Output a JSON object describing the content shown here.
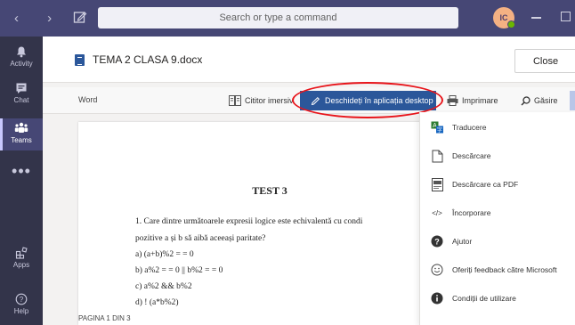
{
  "titlebar": {
    "nav_arrows": "‹  ›",
    "search_placeholder": "Search or type a command",
    "avatar_initials": "IC"
  },
  "rail": {
    "items": [
      {
        "label": "Activity"
      },
      {
        "label": "Chat"
      },
      {
        "label": "Teams"
      },
      {
        "label": "Apps"
      },
      {
        "label": "Help"
      }
    ],
    "more": "•••"
  },
  "document": {
    "title": "TEMA 2 CLASA 9.docx",
    "close_label": "Close",
    "app_label": "Word"
  },
  "toolbar": {
    "immersive_reader": "Cititor imersiv",
    "open_desktop": "Deschideți în aplicația desktop",
    "print": "Imprimare",
    "find": "Găsire"
  },
  "page": {
    "heading": "TEST 3",
    "lines": [
      "1. Care dintre următoarele expresii logice este echivalentă cu condi",
      "pozitive a și b să aibă aceeași paritate?",
      "a) (a+b)%2 = = 0",
      "b) a%2 = = 0 || b%2 = = 0",
      "c) a%2 && b%2",
      "d) ! (a*b%2)"
    ]
  },
  "status": {
    "page_indicator": "PAGINA 1 DIN 3"
  },
  "menu": {
    "items": [
      {
        "label": "Traducere",
        "icon": "translate-icon"
      },
      {
        "label": "Descărcare",
        "icon": "download-icon"
      },
      {
        "label": "Descărcare ca PDF",
        "icon": "pdf-icon"
      },
      {
        "label": "Încorporare",
        "icon": "embed-icon"
      },
      {
        "label": "Ajutor",
        "icon": "help-icon"
      },
      {
        "label": "Oferiți feedback către Microsoft",
        "icon": "feedback-icon"
      },
      {
        "label": "Condiții de utilizare",
        "icon": "info-icon"
      }
    ]
  },
  "colors": {
    "titlebar": "#464775",
    "rail": "#33344a",
    "word_blue": "#2b579a",
    "highlight_oval": "#e8151b"
  }
}
